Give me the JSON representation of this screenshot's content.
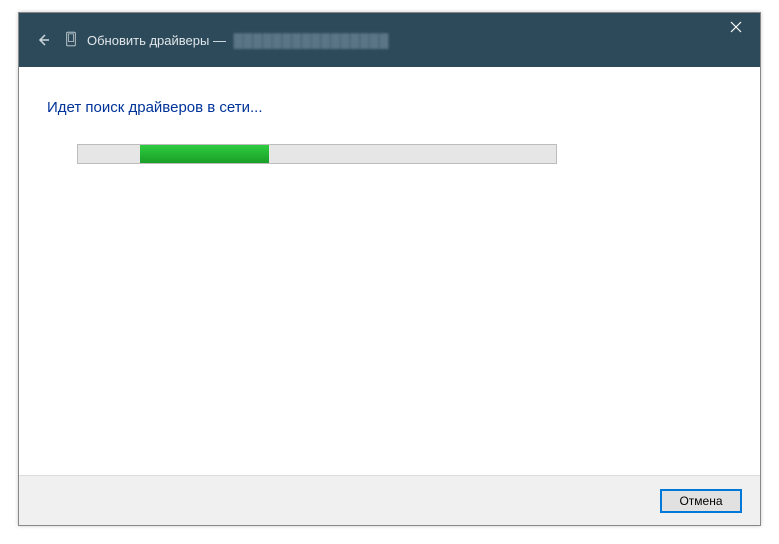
{
  "titlebar": {
    "back_icon": "back-arrow",
    "device_icon": "device-icon",
    "title_prefix": "Обновить драйверы —",
    "device_name": "████████████████"
  },
  "content": {
    "status_heading": "Идет поиск драйверов в сети..."
  },
  "progress": {
    "chunk_left_percent": 13,
    "chunk_width_percent": 27
  },
  "footer": {
    "cancel_label": "Отмена"
  },
  "colors": {
    "titlebar_bg": "#2d4a5a",
    "heading": "#003399",
    "progress_fill": "#1a9e28",
    "button_focus": "#0078d7"
  }
}
